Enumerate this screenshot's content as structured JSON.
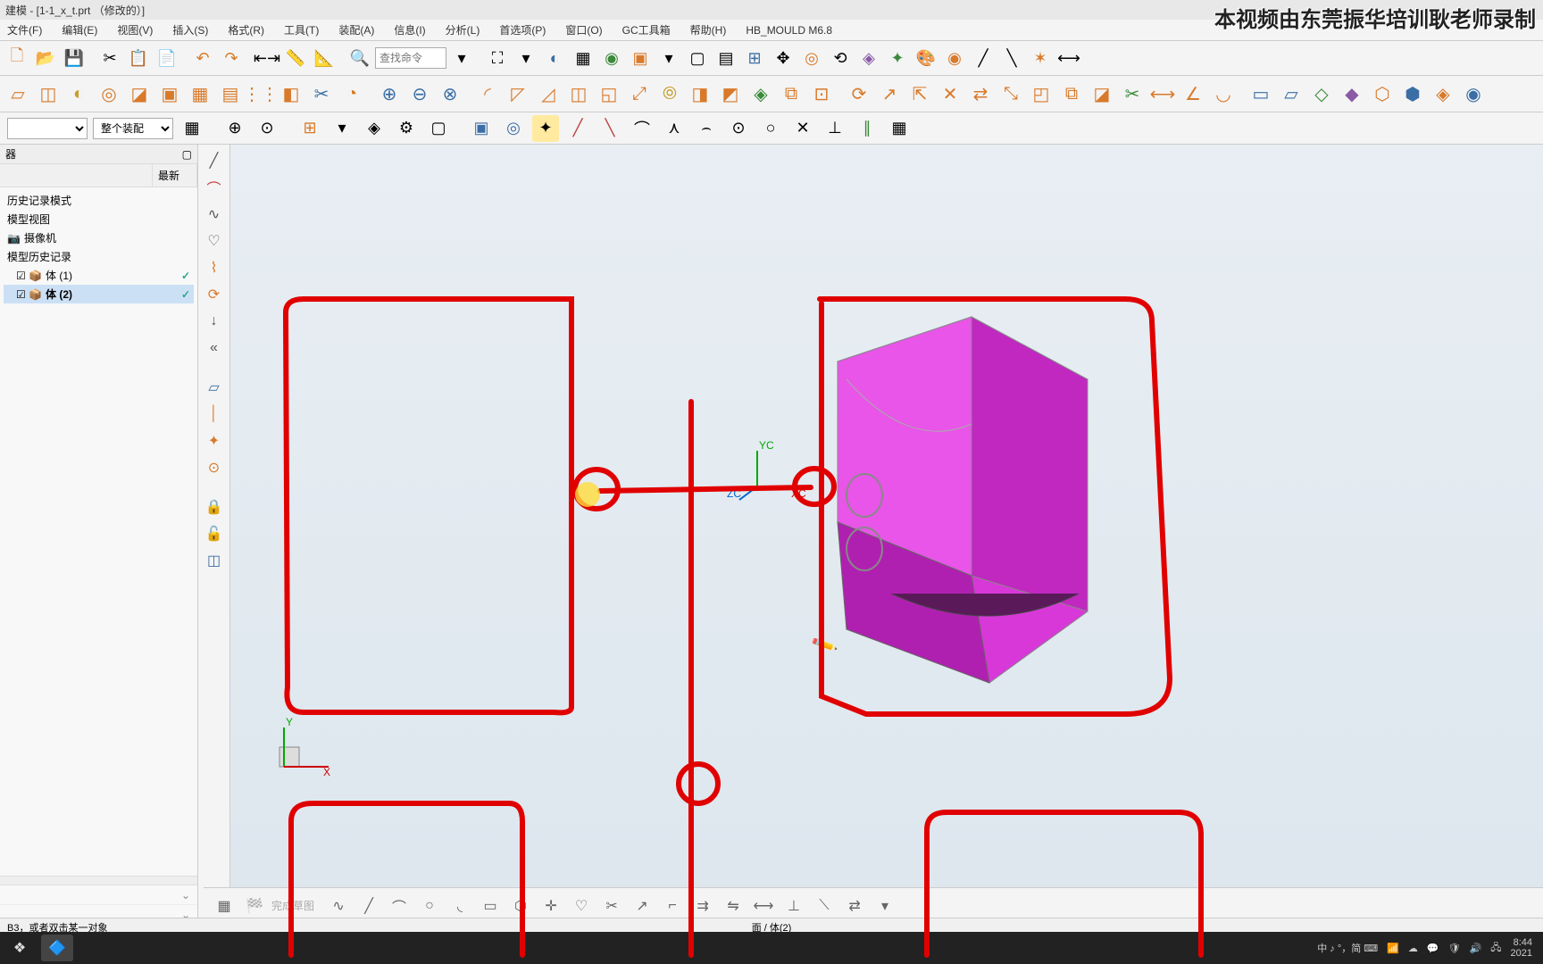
{
  "title": "建模 - [1-1_x_t.prt （修改的）]",
  "watermark": "本视频由东莞振华培训耿老师录制",
  "menu": {
    "file": "文件(F)",
    "edit": "编辑(E)",
    "view": "视图(V)",
    "insert": "插入(S)",
    "format": "格式(R)",
    "tools": "工具(T)",
    "assemblies": "装配(A)",
    "info": "信息(I)",
    "analysis": "分析(L)",
    "preferences": "首选项(P)",
    "window": "窗口(O)",
    "gctools": "GC工具箱",
    "help": "帮助(H)",
    "hbmould": "HB_MOULD M6.8"
  },
  "search": {
    "placeholder": "查找命令"
  },
  "sub": {
    "select_empty": "",
    "assembly": "整个装配"
  },
  "panel": {
    "title": "器",
    "col_name": "",
    "col_latest": "最新",
    "tree": {
      "history_mode": "历史记录模式",
      "model_view": "模型视图",
      "camera": "摄像机",
      "model_history": "模型历史记录",
      "body1": "体 (1)",
      "body2": "体 (2)"
    }
  },
  "coords": {
    "yc": "YC",
    "xc": "XC",
    "zc": "ZC",
    "y": "Y",
    "x": "X"
  },
  "bottom_label": "完成草图",
  "status": {
    "left": "B3，或者双击某一对象",
    "center": "面 / 体(2)"
  },
  "taskbar": {
    "ime": "中 ♪ °，简 ⌨",
    "time": "8:44",
    "date": "2021"
  }
}
